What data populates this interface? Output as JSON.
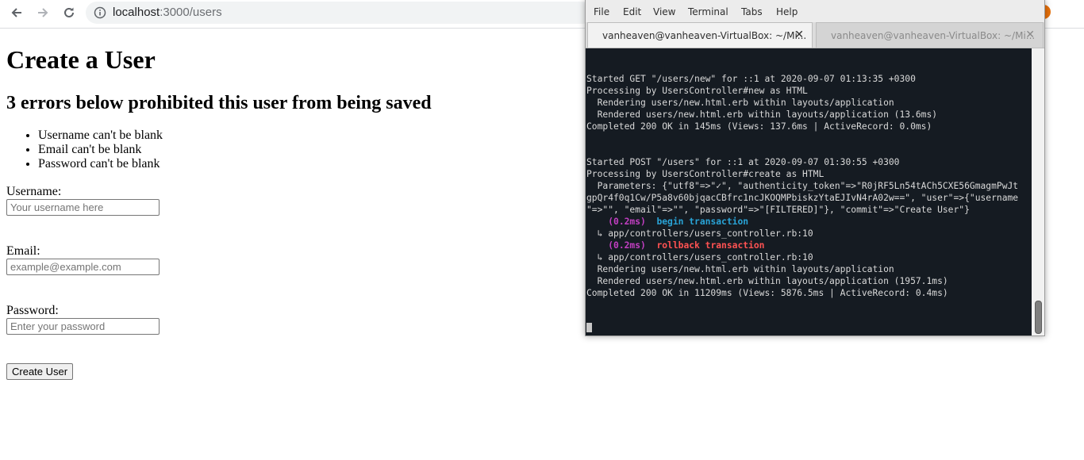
{
  "browser": {
    "url_host": "localhost",
    "url_path": ":3000/users",
    "accent": "#e8710a"
  },
  "page": {
    "title": "Create a User",
    "error_heading": "3 errors below prohibited this user from being saved",
    "errors": [
      "Username can't be blank",
      "Email can't be blank",
      "Password can't be blank"
    ],
    "form": {
      "username_label": "Username:",
      "username_placeholder": "Your username here",
      "email_label": "Email:",
      "email_placeholder": "example@example.com",
      "password_label": "Password:",
      "password_placeholder": "Enter your password",
      "submit_label": "Create User"
    }
  },
  "terminal": {
    "menu": [
      "File",
      "Edit",
      "View",
      "Terminal",
      "Tabs",
      "Help"
    ],
    "tabs": [
      {
        "title": "vanheaven@vanheaven-VirtualBox: ~/Mi...",
        "active": true
      },
      {
        "title": "vanheaven@vanheaven-VirtualBox: ~/Mi...",
        "active": false
      }
    ],
    "lines": [
      "Started GET \"/users/new\" for ::1 at 2020-09-07 01:13:35 +0300",
      "Processing by UsersController#new as HTML",
      "  Rendering users/new.html.erb within layouts/application",
      "  Rendered users/new.html.erb within layouts/application (13.6ms)",
      "Completed 200 OK in 145ms (Views: 137.6ms | ActiveRecord: 0.0ms)",
      "",
      "",
      "Started POST \"/users\" for ::1 at 2020-09-07 01:30:55 +0300",
      "Processing by UsersController#create as HTML",
      "  Parameters: {\"utf8\"=>\"✓\", \"authenticity_token\"=>\"R0jRF5Ln54tACh5CXE56GmagmPwJt",
      "gpQr4f0q1Cw/P5a8v60bjqacCBfrc1ncJKOQMPbiskzYtaEJIvN4rA02w==\", \"user\"=>{\"username",
      "\"=>\"\", \"email\"=>\"\", \"password\"=>\"[FILTERED]\"}, \"commit\"=>\"Create User\"}",
      "  ↳ app/controllers/users_controller.rb:10",
      "  ↳ app/controllers/users_controller.rb:10",
      "  Rendering users/new.html.erb within layouts/application",
      "  Rendered users/new.html.erb within layouts/application (1957.1ms)",
      "Completed 200 OK in 11209ms (Views: 5876.5ms | ActiveRecord: 0.4ms)"
    ],
    "sql": [
      {
        "time": "(0.2ms)",
        "stmt": "begin transaction",
        "color": "#29a3d6"
      },
      {
        "time": "(0.2ms)",
        "stmt": "rollback transaction",
        "color": "#ff5252"
      }
    ]
  }
}
